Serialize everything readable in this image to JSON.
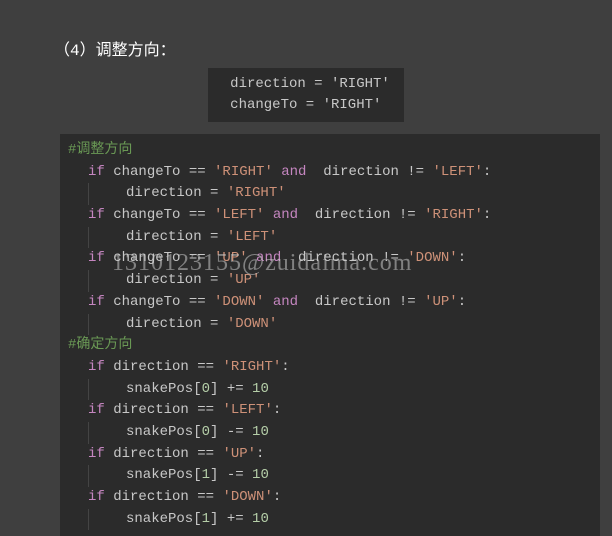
{
  "heading": "（4）调整方向：",
  "top_code": {
    "line1": "direction = 'RIGHT'",
    "line2": "changeTo = 'RIGHT'"
  },
  "code": {
    "comment1": "#调整方向",
    "if1a": "if",
    "if1b": " changeTo == ",
    "if1s1": "'RIGHT'",
    "if1c": " and",
    "if1d": "  direction != ",
    "if1s2": "'LEFT'",
    "if1e": ":",
    "body1": "direction = ",
    "body1s": "'RIGHT'",
    "if2b": " changeTo == ",
    "if2s1": "'LEFT'",
    "if2c": " and",
    "if2d": "  direction != ",
    "if2s2": "'RIGHT'",
    "body2": "direction = ",
    "body2s": "'LEFT'",
    "if3b": " changeTo == ",
    "if3s1": "'UP'",
    "if3c": " and",
    "if3d": "  direction != ",
    "if3s2": "'DOWN'",
    "body3": "direction = ",
    "body3s": "'UP'",
    "if4b": " changeTo == ",
    "if4s1": "'DOWN'",
    "if4c": " and",
    "if4d": "  direction != ",
    "if4s2": "'UP'",
    "body4": "direction = ",
    "body4s": "'DOWN'",
    "comment2": "#确定方向",
    "d1a": " direction == ",
    "d1s": "'RIGHT'",
    "d1body": "snakePos[",
    "d1idx": "0",
    "d1op": "] += ",
    "d1num": "10",
    "d2s": "'LEFT'",
    "d2op": "] -= ",
    "d3s": "'UP'",
    "d3idx": "1",
    "d4s": "'DOWN'",
    "d4op": "] += "
  },
  "watermark": "1310123155@zuidaima.com"
}
